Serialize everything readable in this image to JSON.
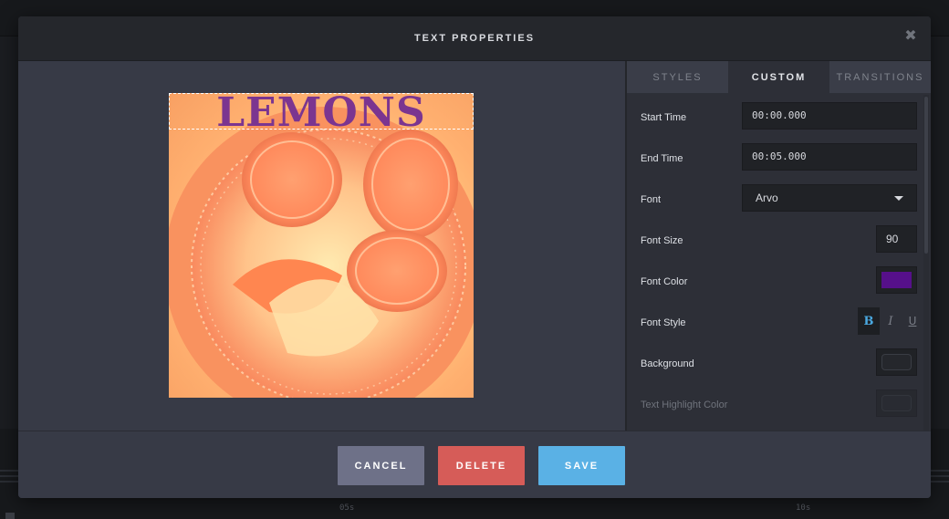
{
  "background": {
    "ruler_labels": [
      "05s",
      "10s"
    ]
  },
  "modal": {
    "title": "TEXT PROPERTIES",
    "close_icon": "close-icon",
    "close_glyph": "✖"
  },
  "preview": {
    "overlay_text": "LEMONS",
    "text_color": "#7b3590"
  },
  "tabs": [
    {
      "label": "STYLES",
      "active": false
    },
    {
      "label": "CUSTOM",
      "active": true
    },
    {
      "label": "TRANSITIONS",
      "active": false
    }
  ],
  "fields": {
    "start_time": {
      "label": "Start Time",
      "value": "00:00.000"
    },
    "end_time": {
      "label": "End Time",
      "value": "00:05.000"
    },
    "font": {
      "label": "Font",
      "value": "Arvo"
    },
    "font_size": {
      "label": "Font Size",
      "value": "90"
    },
    "font_color": {
      "label": "Font Color",
      "value": "#56108a"
    },
    "font_style": {
      "label": "Font Style",
      "bold": "B",
      "italic": "I",
      "underline": "U",
      "bold_active": true
    },
    "background": {
      "label": "Background"
    },
    "text_highlight": {
      "label": "Text Highlight Color"
    }
  },
  "footer": {
    "cancel_label": "CANCEL",
    "delete_label": "DELETE",
    "save_label": "SAVE"
  },
  "colors": {
    "accent_blue": "#5ab1e5",
    "danger_red": "#d65c58",
    "neutral_button": "#6e7188"
  }
}
